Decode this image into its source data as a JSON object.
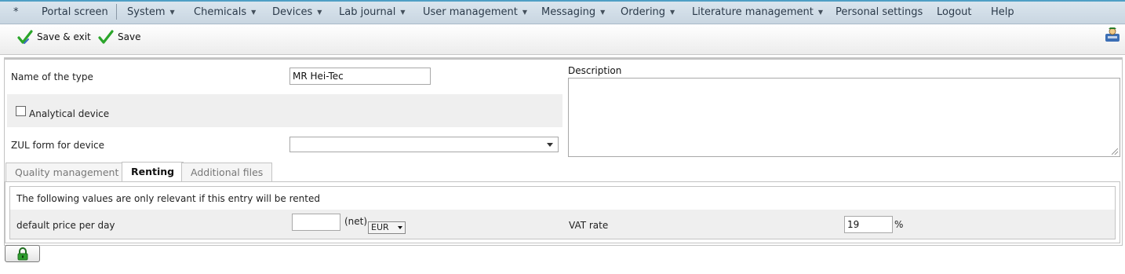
{
  "menu": {
    "items": [
      {
        "label": "*",
        "has_arrow": false
      },
      {
        "label": "Portal screen",
        "has_arrow": false
      },
      {
        "label": "System",
        "has_arrow": true
      },
      {
        "label": "Chemicals",
        "has_arrow": true
      },
      {
        "label": "Devices",
        "has_arrow": true
      },
      {
        "label": "Lab journal",
        "has_arrow": true
      },
      {
        "label": "User management",
        "has_arrow": true
      },
      {
        "label": "Messaging",
        "has_arrow": true
      },
      {
        "label": "Ordering",
        "has_arrow": true
      },
      {
        "label": "Literature management",
        "has_arrow": true
      },
      {
        "label": "Personal settings",
        "has_arrow": false
      },
      {
        "label": "Logout",
        "has_arrow": false
      },
      {
        "label": "Help",
        "has_arrow": false
      }
    ],
    "arrow_glyph": "▼"
  },
  "toolbar": {
    "save_exit_label": "Save & exit",
    "save_label": "Save",
    "check_icon": "check-icon",
    "right_icon": "user-settings-icon"
  },
  "form": {
    "name_label": "Name of the type",
    "name_value": "MR Hei-Tec",
    "analytical_label": "Analytical device",
    "analytical_checked": false,
    "zul_label": "ZUL form for device",
    "zul_value": "",
    "description_label": "Description",
    "description_value": ""
  },
  "tabs": [
    {
      "label": "Quality management",
      "active": false
    },
    {
      "label": "Renting",
      "active": true
    },
    {
      "label": "Additional files",
      "active": false
    }
  ],
  "renting": {
    "note": "The following values are only relevant if this entry will be rented",
    "price_label": "default price per day",
    "price_value": "",
    "net_label": "(net)",
    "currency": "EUR",
    "vat_label": "VAT rate",
    "vat_value": "19",
    "percent": "%"
  },
  "lock_button": {
    "icon": "lock-icon"
  },
  "colors": {
    "menu_bg": "#cfdbe6",
    "menu_accent": "#4f9fc5",
    "check_green": "#2aa52a",
    "lock_green": "#2e9e2e"
  }
}
